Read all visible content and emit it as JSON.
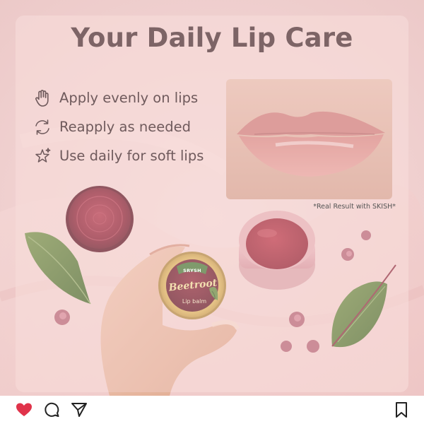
{
  "post": {
    "title": "Your Daily Lip Care",
    "benefits": [
      {
        "icon": "hand-icon",
        "text": "Apply evenly on lips"
      },
      {
        "icon": "refresh-icon",
        "text": "Reapply as needed"
      },
      {
        "icon": "sparkle-star-icon",
        "text": "Use daily for soft lips"
      }
    ],
    "result_note": "*Real Result with SKISH*",
    "product": {
      "brand": "SRYSH",
      "name": "Beetroot",
      "type": "Lip balm"
    }
  },
  "actions": [
    {
      "name": "like",
      "icon": "heart-icon",
      "color": "#e0334a"
    },
    {
      "name": "comment",
      "icon": "comment-icon"
    },
    {
      "name": "share",
      "icon": "send-icon"
    },
    {
      "name": "save",
      "icon": "bookmark-icon"
    }
  ],
  "colors": {
    "title": "#7d6466",
    "body_text": "#6f5a5c",
    "background": "#f7e9e5",
    "balm": "#a82a3d",
    "like_red": "#e0334a"
  }
}
